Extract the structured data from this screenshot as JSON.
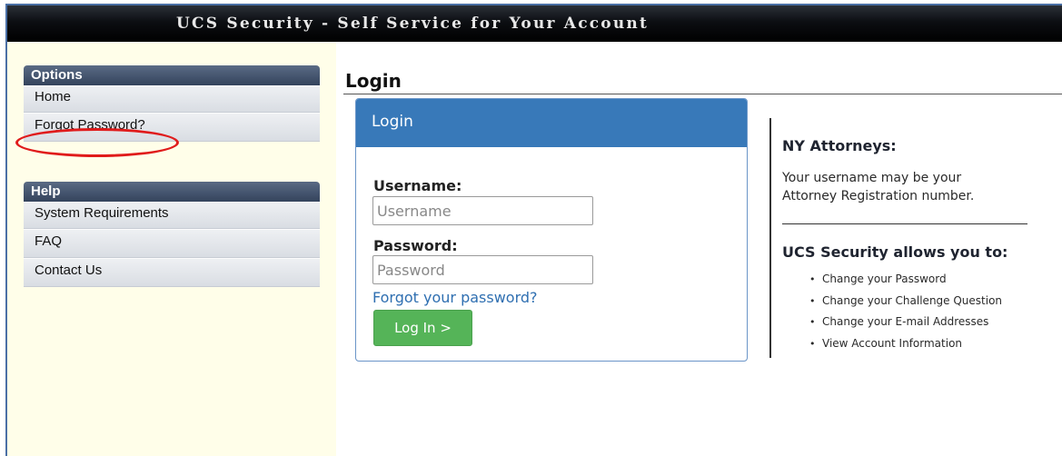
{
  "header": {
    "title": "UCS Security - Self Service for Your Account"
  },
  "sidebar": {
    "options_panel": {
      "title": "Options",
      "items": [
        {
          "label": "Home"
        },
        {
          "label": "Forgot Password?"
        }
      ]
    },
    "help_panel": {
      "title": "Help",
      "items": [
        {
          "label": "System Requirements"
        },
        {
          "label": "FAQ"
        },
        {
          "label": "Contact Us"
        }
      ]
    }
  },
  "main": {
    "title": "Login",
    "login_card": {
      "header": "Login",
      "username_label": "Username:",
      "username_placeholder": "Username",
      "username_value": "",
      "password_label": "Password:",
      "password_placeholder": "Password",
      "password_value": "",
      "forgot_link": "Forgot your password?",
      "login_button": "Log In >"
    },
    "info": {
      "heading1": "NY Attorneys:",
      "text1": "Your username may be your Attorney Registration number.",
      "heading2": "UCS Security allows you to:",
      "bullets": [
        "Change your Password",
        "Change your Challenge Question",
        "Change your E-mail Addresses",
        "View Account Information"
      ]
    }
  },
  "colors": {
    "header_bg": "#000000",
    "sidebar_bg": "#fffee9",
    "panel_header": "#3b4a63",
    "card_header": "#3879b9",
    "login_button": "#55b458",
    "link": "#2f6fb1",
    "highlight_ring": "#e01b1b"
  }
}
